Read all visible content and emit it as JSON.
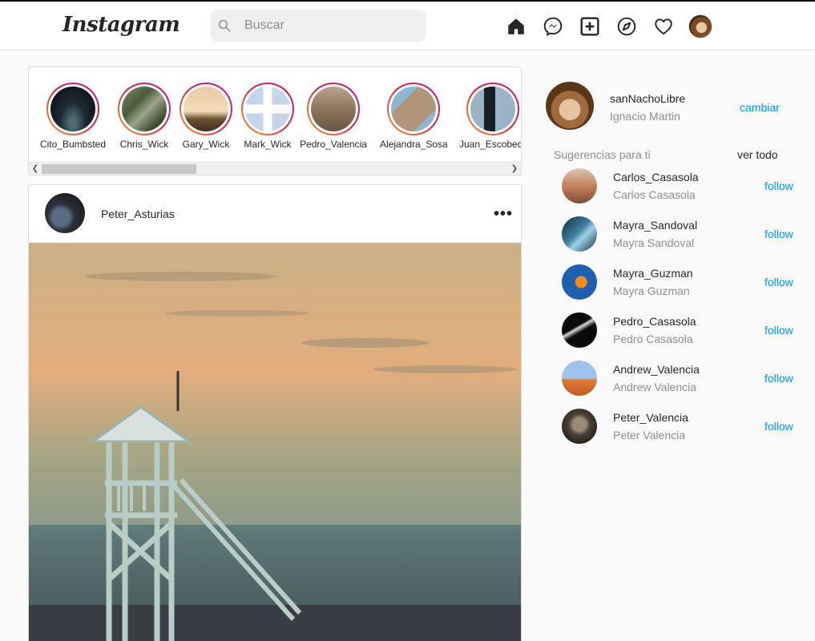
{
  "header": {
    "logo": "Instagram",
    "search_placeholder": "Buscar",
    "nav_icons": [
      "home-icon",
      "messenger-icon",
      "new-post-icon",
      "explore-icon",
      "activity-heart-icon",
      "profile-avatar"
    ]
  },
  "stories": [
    {
      "username": "Cito_Bumbsted"
    },
    {
      "username": "Chris_Wick"
    },
    {
      "username": "Gary_Wick"
    },
    {
      "username": "Mark_Wick"
    },
    {
      "username": "Pedro_Valencia"
    },
    {
      "username": "Alejandra_Sosa"
    },
    {
      "username": "Juan_Escobedo"
    }
  ],
  "post": {
    "username": "Peter_Asturias",
    "more_label": "•••"
  },
  "me": {
    "username": "sanNachoLibre",
    "name": "Ignacio Martin",
    "switch_label": "cambiar"
  },
  "suggestions": {
    "title": "Sugerencias para ti",
    "see_all": "ver todo",
    "follow_label": "follow",
    "items": [
      {
        "username": "Carlos_Casasola",
        "name": "Carlos Casasola"
      },
      {
        "username": "Mayra_Sandoval",
        "name": "Mayra Sandoval"
      },
      {
        "username": "Mayra_Guzman",
        "name": "Mayra Guzman"
      },
      {
        "username": "Pedro_Casasola",
        "name": "Pedro Casasola"
      },
      {
        "username": "Andrew_Valencia",
        "name": "Andrew Valencia"
      },
      {
        "username": "Peter_Valencia",
        "name": "Peter Valencia"
      }
    ]
  },
  "colors": {
    "link_blue": "#0095f6",
    "muted_text": "#8e8e8e",
    "story_ring_start": "#f09433",
    "story_ring_end": "#bc1888"
  }
}
